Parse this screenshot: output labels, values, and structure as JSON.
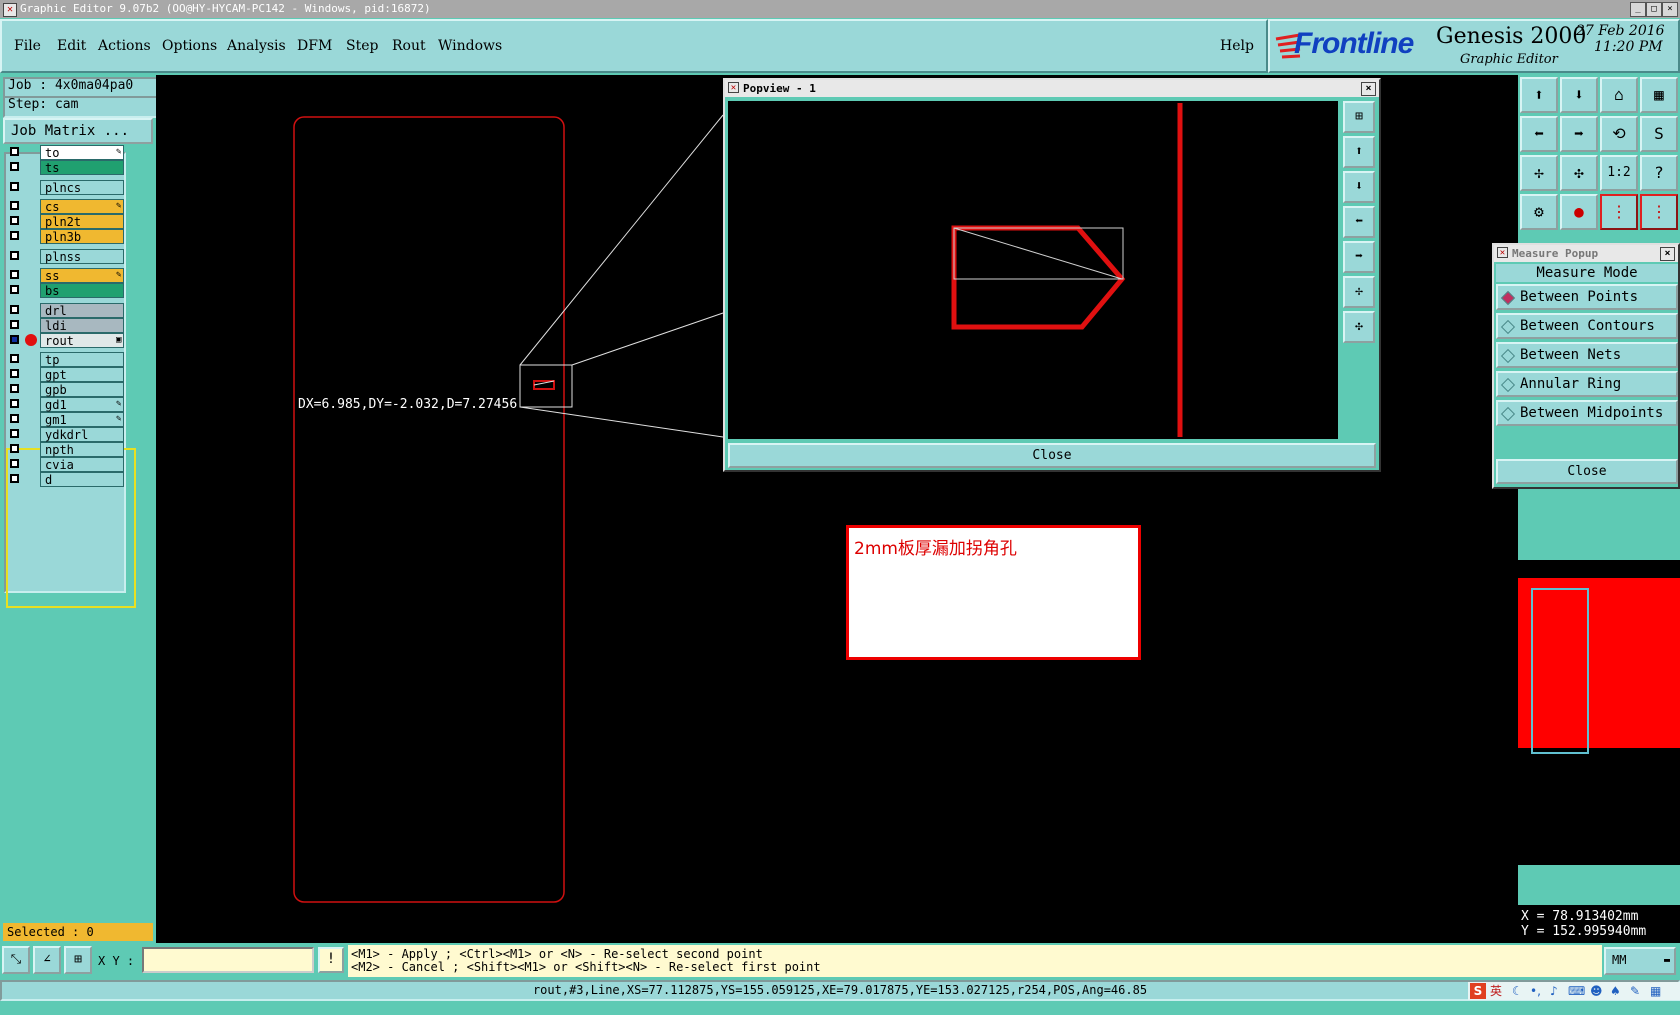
{
  "window": {
    "title": "Graphic Editor 9.07b2 (OO@HY-HYCAM-PC142 - Windows, pid:16872)",
    "min": "_",
    "max": "□",
    "close": "×"
  },
  "menu": {
    "items": [
      "File",
      "Edit",
      "Actions",
      "Options",
      "Analysis",
      "DFM",
      "Step",
      "Rout",
      "Windows"
    ],
    "help": "Help"
  },
  "logo": {
    "brand": "Frontline",
    "product": "Genesis 2000",
    "subtitle": "Graphic Editor",
    "date": "27 Feb 2016",
    "time": "11:20 PM"
  },
  "job": {
    "job_label": "Job : 4x0ma04pa0",
    "step_label": "Step: cam",
    "matrix_button": "Job Matrix ..."
  },
  "layers": [
    {
      "name": "to",
      "bg": "#ffffff",
      "mark": "✎"
    },
    {
      "name": "ts",
      "bg": "#20a070",
      "mark": ""
    },
    {
      "name": "plncs",
      "bg": "#9ad8d8",
      "mark": ""
    },
    {
      "name": "cs",
      "bg": "#f0b830",
      "mark": "✎"
    },
    {
      "name": "pln2t",
      "bg": "#f0b830",
      "mark": ""
    },
    {
      "name": "pln3b",
      "bg": "#f0b830",
      "mark": ""
    },
    {
      "name": "plnss",
      "bg": "#9ad8d8",
      "mark": ""
    },
    {
      "name": "ss",
      "bg": "#f0b830",
      "mark": "✎"
    },
    {
      "name": "bs",
      "bg": "#20a070",
      "mark": ""
    },
    {
      "name": "drl",
      "bg": "#a8b8c0",
      "mark": ""
    },
    {
      "name": "ldi",
      "bg": "#a8b8c0",
      "mark": ""
    },
    {
      "name": "rout",
      "bg": "#e0e8e8",
      "mark": "▣"
    },
    {
      "name": "tp",
      "bg": "#9ad8d8",
      "mark": ""
    },
    {
      "name": "gpt",
      "bg": "#9ad8d8",
      "mark": ""
    },
    {
      "name": "gpb",
      "bg": "#9ad8d8",
      "mark": ""
    },
    {
      "name": "gd1",
      "bg": "#9ad8d8",
      "mark": "✎"
    },
    {
      "name": "gm1",
      "bg": "#9ad8d8",
      "mark": "✎"
    },
    {
      "name": "ydkdrl",
      "bg": "#9ad8d8",
      "mark": ""
    },
    {
      "name": "npth",
      "bg": "#9ad8d8",
      "mark": ""
    },
    {
      "name": "cvia",
      "bg": "#9ad8d8",
      "mark": ""
    },
    {
      "name": "d",
      "bg": "#9ad8d8",
      "mark": ""
    }
  ],
  "selected": "Selected : 0",
  "canvas": {
    "measure_text": "DX=6.985,DY=-2.032,D=7.27456",
    "note_text": "2mm板厚漏加拐角孔"
  },
  "popview": {
    "title": "Popview - 1",
    "close_label": "Close",
    "close_x": "×"
  },
  "measure_popup": {
    "title": "Measure Popup",
    "mode_header": "Measure Mode",
    "options": [
      "Between Points",
      "Between Contours",
      "Between Nets",
      "Annular Ring",
      "Between Midpoints"
    ],
    "selected_index": 0,
    "close_label": "Close",
    "close_x": "×"
  },
  "coords": {
    "x": "X = 78.913402mm",
    "y": "Y = 152.995940mm"
  },
  "status": {
    "xy_label": "X Y :",
    "xy_value": "",
    "hint1": "<M1> - Apply  ; <Ctrl><M1> or <N> - Re-select second point",
    "hint2": "<M2> - Cancel ; <Shift><M1> or <Shift><N> - Re-select first point",
    "units": "MM",
    "info": "rout,#3,Line,XS=77.112875,YS=155.059125,XE=79.017875,YE=153.027125,r254,POS,Ang=46.85"
  },
  "tray": {
    "ime_label": "英"
  },
  "colors": {
    "canvas": "#000000",
    "rout_outline": "#d01010",
    "highlight": "#e8e020",
    "panel": "#5ecab4",
    "button": "#9ad8d8"
  }
}
